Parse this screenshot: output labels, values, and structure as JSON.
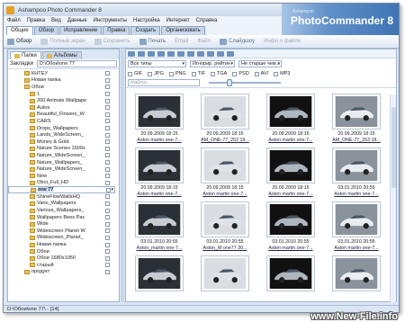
{
  "window": {
    "title": "Ashampoo Photo Commander 8"
  },
  "menu": [
    "Файл",
    "Правка",
    "Вид",
    "Данные",
    "Инструменты",
    "Настройка",
    "Интернет",
    "Справка"
  ],
  "ribbon_tabs": [
    "Общие",
    "Обзор",
    "Исправление",
    "Правка",
    "Создать",
    "Организовать"
  ],
  "brand": {
    "sub": "Ashampoo",
    "name": "PhotoCommander 8"
  },
  "toolbar": [
    "Обзор",
    "Полный экран",
    "Сохранить",
    "Печать",
    "Email",
    "Файл",
    "Слайдшоу",
    "Инфо о файле"
  ],
  "left_tabs": [
    "Папки",
    "Альбомы"
  ],
  "bookmarks": {
    "label": "Закладки",
    "path": "D:\\Обои\\one 77"
  },
  "tree": [
    {
      "name": "КНТЕУ",
      "depth": 2
    },
    {
      "name": "Новая папка",
      "depth": 2
    },
    {
      "name": "Обои",
      "depth": 2
    },
    {
      "name": "1",
      "depth": 3
    },
    {
      "name": "200 Animals Wallpape",
      "depth": 3
    },
    {
      "name": "Autos",
      "depth": 3
    },
    {
      "name": "Beautiful_Flowers_W",
      "depth": 3
    },
    {
      "name": "CARS",
      "depth": 3
    },
    {
      "name": "Drops_Wallpapers",
      "depth": 3
    },
    {
      "name": "Lands_WideScreen_",
      "depth": 3
    },
    {
      "name": "Money & Gold",
      "depth": 3
    },
    {
      "name": "Nature Scenes 1600x",
      "depth": 3
    },
    {
      "name": "Nature_WideScreen_",
      "depth": 3
    },
    {
      "name": "Nature_Wallpapers_",
      "depth": 3
    },
    {
      "name": "Nature_WideScreen_",
      "depth": 3
    },
    {
      "name": "New",
      "depth": 3
    },
    {
      "name": "Oboi_Full_HD",
      "depth": 3
    },
    {
      "name": "one 77",
      "depth": 3,
      "selected": true
    },
    {
      "name": "ShineFlowWallsHQ",
      "depth": 3
    },
    {
      "name": "Vario_Wallpapers",
      "depth": 3
    },
    {
      "name": "Various_Wallpapers_",
      "depth": 3
    },
    {
      "name": "Wallpapers Bees Pac",
      "depth": 3
    },
    {
      "name": "Wide",
      "depth": 3
    },
    {
      "name": "Widescreen Planet W",
      "depth": 3
    },
    {
      "name": "Widescreen_Planet_",
      "depth": 3
    },
    {
      "name": "Новая папка",
      "depth": 3
    },
    {
      "name": "Обои",
      "depth": 3
    },
    {
      "name": "Обои 1680x1050",
      "depth": 3
    },
    {
      "name": "старый",
      "depth": 3
    },
    {
      "name": "продукт",
      "depth": 2
    }
  ],
  "filters": {
    "type": "Все типы",
    "mode": "Игнорир. рейтин",
    "age": "Не старше чем..."
  },
  "file_types": [
    "GIF",
    "JPG",
    "PNG",
    "TIF",
    "TGA",
    "PSD",
    "AVI",
    "MP3"
  ],
  "search_placeholder": "Найти...",
  "thumbnails": [
    {
      "date": "20.09.2009 18:15",
      "name": "Aston martin one-7..."
    },
    {
      "date": "20.09.2009 18:15",
      "name": "AM_ONE-77_252 19..."
    },
    {
      "date": "20.09.2009 18:15",
      "name": "Aston martin one-7..."
    },
    {
      "date": "20.09.2009 18:15",
      "name": "AM_ONE-77_253 18..."
    },
    {
      "date": "20.09.2009 18:15",
      "name": "Aston martin one-7..."
    },
    {
      "date": "20.09.2009 18:15",
      "name": "Aston martin one-7..."
    },
    {
      "date": "20.09.2009 18:15",
      "name": "Aston martin one-7..."
    },
    {
      "date": "03.01.2010 20:55",
      "name": "Aston martin one-7..."
    },
    {
      "date": "03.01.2010 20:55",
      "name": "Aston_martin one-7..."
    },
    {
      "date": "03.01.2010 20:55",
      "name": "Aston_M one77 30..."
    },
    {
      "date": "03.01.2010 20:55",
      "name": "Aston martin one-7..."
    },
    {
      "date": "03.01.2010 20:55",
      "name": "Aston martin one-7..."
    },
    {
      "date": "",
      "name": ""
    },
    {
      "date": "",
      "name": ""
    },
    {
      "date": "",
      "name": ""
    },
    {
      "date": "",
      "name": ""
    }
  ],
  "status": "D:\\Обои\\one 77\\ - [14]",
  "watermark": "www.New-File.info"
}
